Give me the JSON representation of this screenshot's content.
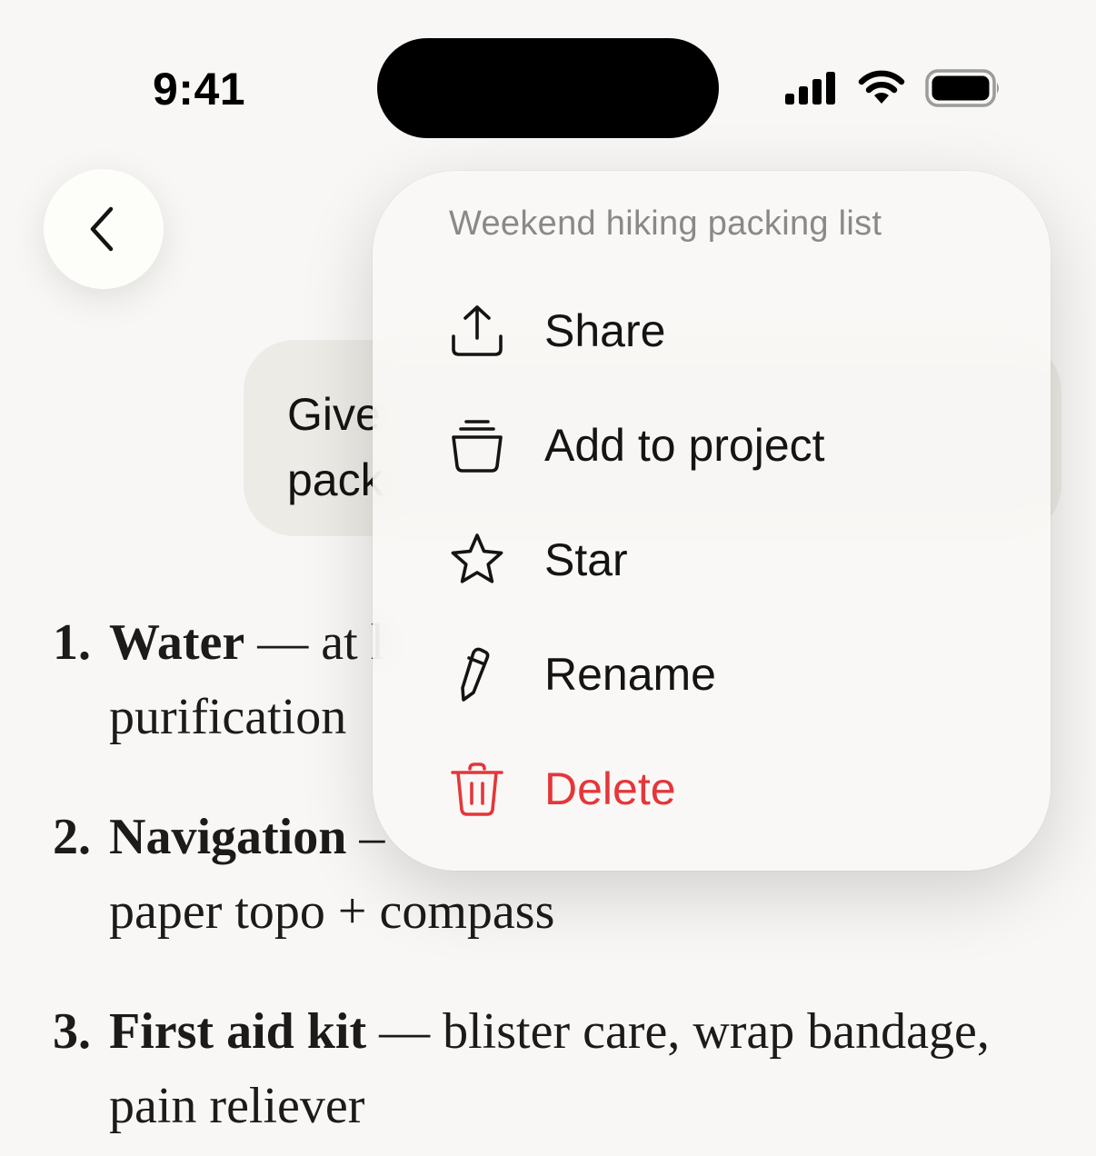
{
  "status_bar": {
    "time": "9:41",
    "icons": [
      "cellular-signal-icon",
      "wifi-icon",
      "battery-icon"
    ]
  },
  "nav": {
    "back_icon": "chevron-left-icon"
  },
  "conversation": {
    "user_message_visible": "Give\npack"
  },
  "response": {
    "items": [
      {
        "number": "1.",
        "title": "Water",
        "separator": " — ",
        "text_visible_line1": "at l",
        "text_visible_line2": "purification"
      },
      {
        "number": "2.",
        "title": "Navigation",
        "separator": " –",
        "text_visible_line2": "paper topo + compass"
      },
      {
        "number": "3.",
        "title": "First aid kit",
        "separator": " — ",
        "text": "blister care, wrap bandage, pain reliever"
      }
    ]
  },
  "context_menu": {
    "title": "Weekend hiking packing list",
    "items": [
      {
        "label": "Share",
        "icon": "share-icon"
      },
      {
        "label": "Add to project",
        "icon": "project-stack-icon"
      },
      {
        "label": "Star",
        "icon": "star-icon"
      },
      {
        "label": "Rename",
        "icon": "pencil-icon"
      },
      {
        "label": "Delete",
        "icon": "trash-icon",
        "destructive": true
      }
    ],
    "colors": {
      "destructive": "#e5363a",
      "title": "#8a8986"
    }
  }
}
